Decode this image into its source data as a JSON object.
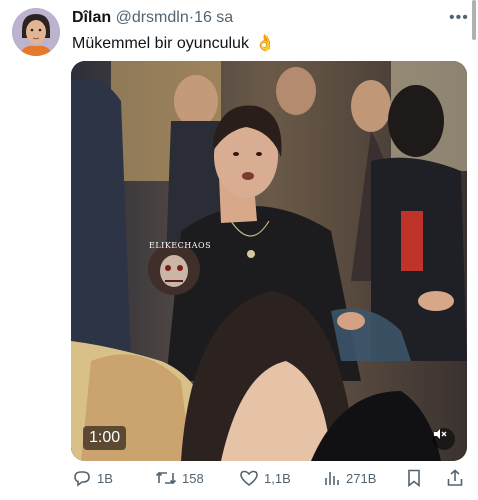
{
  "tweet": {
    "display_name": "Dîlan",
    "handle": "@drsmdln",
    "separator": "·",
    "time": "16 sa",
    "text": "Mükemmel bir oyunculuk",
    "emoji": "👌"
  },
  "media": {
    "duration": "1:00",
    "watermark": "ELIKECHAOS",
    "mute_icon": "speaker-muted-icon"
  },
  "actions": {
    "replies": "1B",
    "retweets": "158",
    "likes": "1,1B",
    "views": "271B"
  },
  "icons": [
    "more-icon",
    "reply-icon",
    "retweet-icon",
    "like-icon",
    "views-icon",
    "bookmark-icon",
    "share-icon"
  ],
  "colors": {
    "text": "#0f1419",
    "secondary": "#536471",
    "background": "#ffffff"
  }
}
